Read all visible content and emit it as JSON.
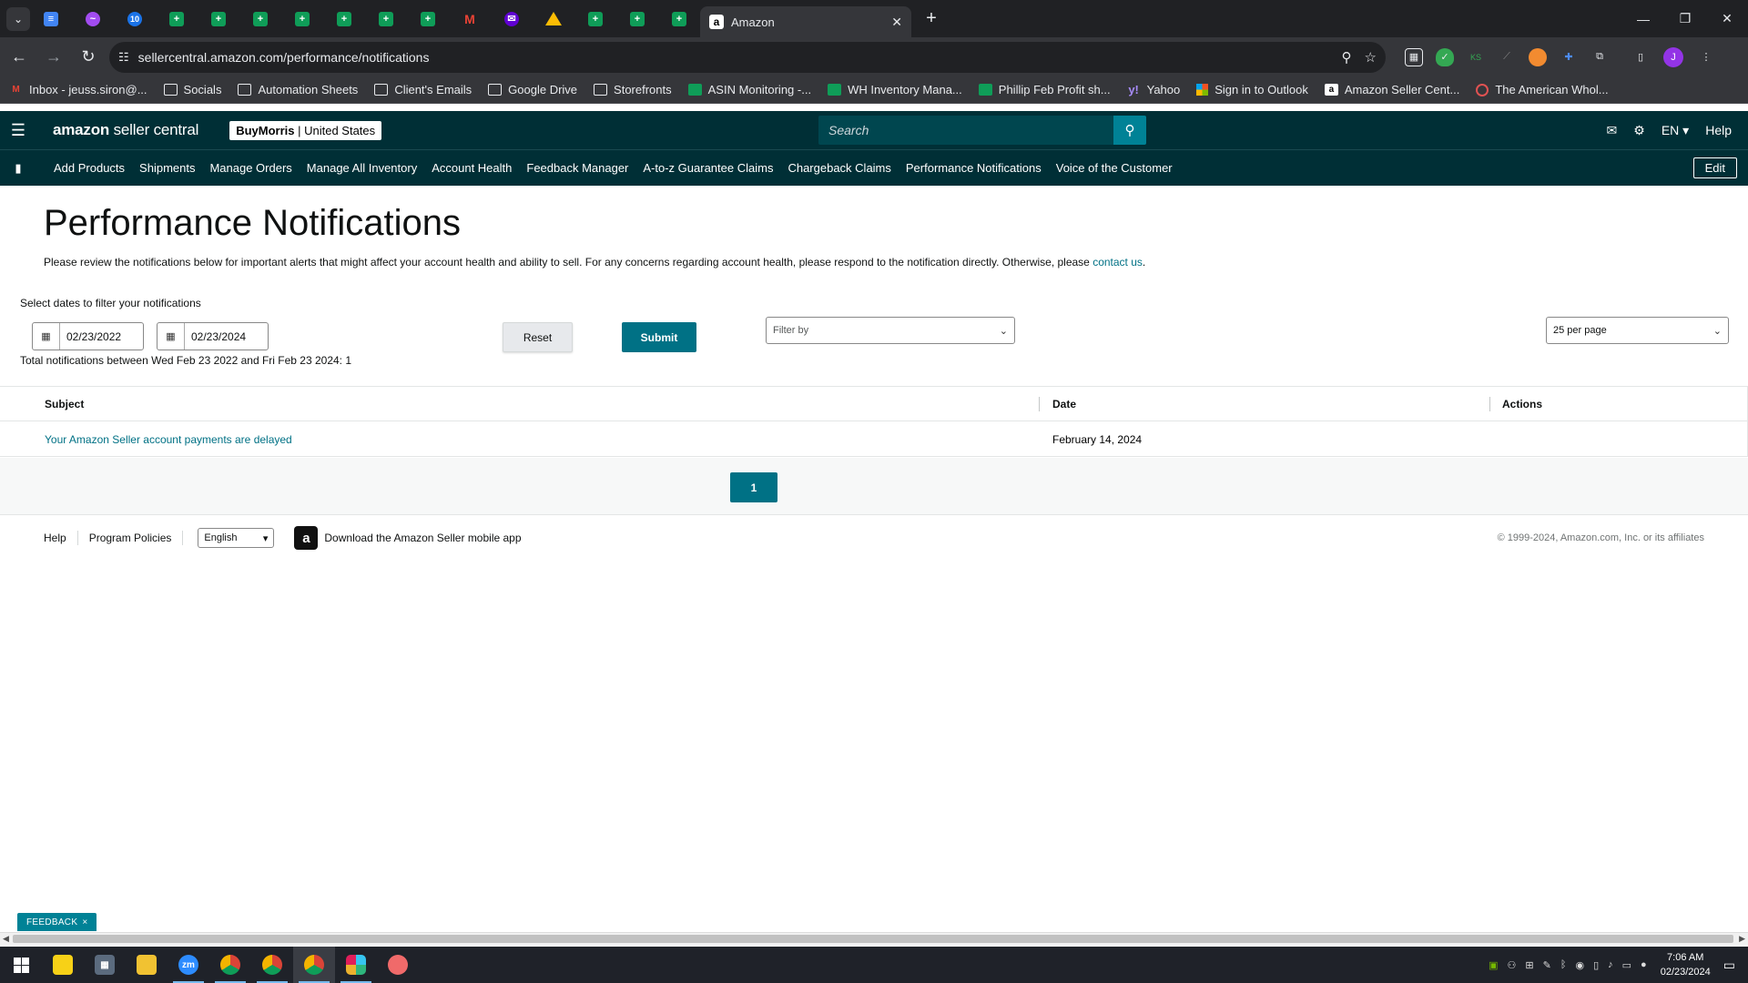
{
  "browser": {
    "active_tab_title": "Amazon",
    "url": "sellercentral.amazon.com/performance/notifications",
    "profile_initial": "J",
    "pinned_tabs": [
      "docs",
      "messenger",
      "ten",
      "sheets",
      "sheets",
      "sheets",
      "sheets",
      "sheets",
      "sheets",
      "sheets",
      "gmail",
      "yahoo-mail",
      "drive",
      "sheets",
      "sheets",
      "sheets"
    ],
    "bookmarks": [
      {
        "label": "Inbox - jeuss.siron@...",
        "icon": "gmail"
      },
      {
        "label": "Socials",
        "icon": "folder"
      },
      {
        "label": "Automation Sheets",
        "icon": "folder"
      },
      {
        "label": "Client's Emails",
        "icon": "folder"
      },
      {
        "label": "Google Drive",
        "icon": "folder"
      },
      {
        "label": "Storefronts",
        "icon": "folder"
      },
      {
        "label": "ASIN Monitoring -...",
        "icon": "sheets"
      },
      {
        "label": "WH Inventory Mana...",
        "icon": "sheets"
      },
      {
        "label": "Phillip Feb Profit sh...",
        "icon": "sheets"
      },
      {
        "label": "Yahoo",
        "icon": "yahoo"
      },
      {
        "label": "Sign in to Outlook",
        "icon": "microsoft"
      },
      {
        "label": "Amazon Seller Cent...",
        "icon": "amazon"
      },
      {
        "label": "The American Whol...",
        "icon": "american-wholesale"
      }
    ]
  },
  "header": {
    "logo_bold": "amazon",
    "logo_rest": " seller central",
    "store_name": "BuyMorris",
    "marketplace": "United States",
    "search_placeholder": "Search",
    "language": "EN",
    "help": "Help"
  },
  "nav": {
    "items": [
      "Add Products",
      "Shipments",
      "Manage Orders",
      "Manage All Inventory",
      "Account Health",
      "Feedback Manager",
      "A-to-z Guarantee Claims",
      "Chargeback Claims",
      "Performance Notifications",
      "Voice of the Customer"
    ],
    "edit_label": "Edit"
  },
  "page": {
    "title": "Performance Notifications",
    "description": "Please review the notifications below for important alerts that might affect your account health and ability to sell. For any concerns regarding account health, please respond to the notification directly. Otherwise, please ",
    "contact_link": "contact us",
    "description_end": "."
  },
  "filters": {
    "label": "Select dates to filter your notifications",
    "start_date": "02/23/2022",
    "end_date": "02/23/2024",
    "reset_label": "Reset",
    "submit_label": "Submit",
    "filter_by_placeholder": "Filter by",
    "per_page": "25 per page",
    "total_text": "Total notifications between Wed Feb 23 2022 and Fri Feb 23 2024: 1"
  },
  "table": {
    "columns": [
      "Subject",
      "Date",
      "Actions"
    ],
    "rows": [
      {
        "subject": "Your Amazon Seller account payments are delayed",
        "date": "February 14, 2024",
        "actions": ""
      }
    ]
  },
  "pagination": {
    "current_page": "1"
  },
  "footer": {
    "help": "Help",
    "program_policies": "Program Policies",
    "language": "English",
    "app_text": "Download the Amazon Seller mobile app",
    "copyright": "© 1999-2024, Amazon.com, Inc. or its affiliates"
  },
  "feedback": {
    "label": "FEEDBACK",
    "close": "×"
  },
  "taskbar": {
    "apps": [
      "sticky-notes",
      "calculator",
      "file-explorer",
      "zoom",
      "chrome",
      "chrome",
      "chrome",
      "slack",
      "asana"
    ],
    "time": "7:06 AM",
    "date": "02/23/2024"
  },
  "colors": {
    "header_bg": "#002f36",
    "accent": "#007185",
    "search_button": "#008296"
  }
}
